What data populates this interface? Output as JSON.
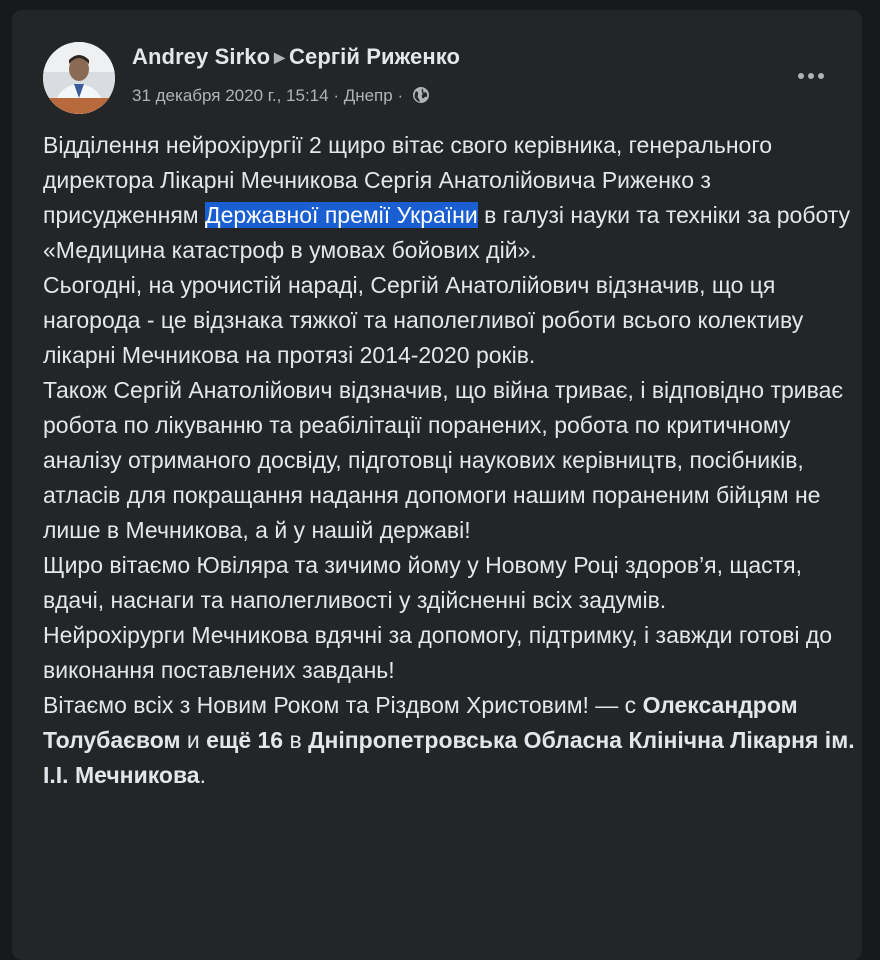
{
  "post": {
    "author": "Andrey Sirko",
    "recipient": "Сергій Риженко",
    "date": "31 декабря 2020 г., 15:14",
    "location_sep": " · ",
    "location": "Днепр",
    "meta_sep": " · ",
    "avatar_icon": "avatar-photo",
    "more_icon": "more-options-icon",
    "globe_icon": "globe-icon",
    "highlight_color": "#1a5fd1",
    "paragraphs": {
      "p1_a": "Відділення нейрохірургії 2 щиро вітає свого керівника, генерального директора Лікарні Мечникова Сергія Анатолійовича Риженко з присудженням ",
      "p1_hl": "Державної премії України",
      "p1_b": " в галузі науки та техніки за роботу «Медицина катастроф в умовах бойових дій».",
      "p2": "Сьогодні, на урочистій нараді, Сергій Анатолійович відзначив, що ця нагорода - це відзнака тяжкої та наполегливої роботи всього колективу лікарні Мечникова на протязі 2014-2020 років.",
      "p3": "Також Сергій Анатолійович відзначив, що війна триває, і відповідно триває робота по лікуванню та реабілітації поранених, робота по критичному аналізу отриманого досвіду, підготовці наукових керівництв, посібників, атласів для покращання надання допомоги нашим пораненим бійцям не лише в Мечникова, а й у нашій державі!",
      "p4": "Щиро вітаємо Ювіляра та зичимо йому у Новому Році здоров’я, щастя, вдачі, наснаги та наполегливості у здійсненні всіх задумів.",
      "p5": "Нейрохірурги Мечникова вдячні за допомогу, підтримку, і завжди готові до виконання поставлених завдань!",
      "p6_a": "Вітаємо всіх з Новим Роком та Різдвом Христовим! — с ",
      "p6_with": "Олександром Толубаєвом",
      "p6_and": " и ",
      "p6_others": "ещё 16",
      "p6_in": " в ",
      "p6_place": "Дніпропетровська Обласна Клінічна Лікарня ім. І.І. Мечникова",
      "p6_end": "."
    }
  }
}
